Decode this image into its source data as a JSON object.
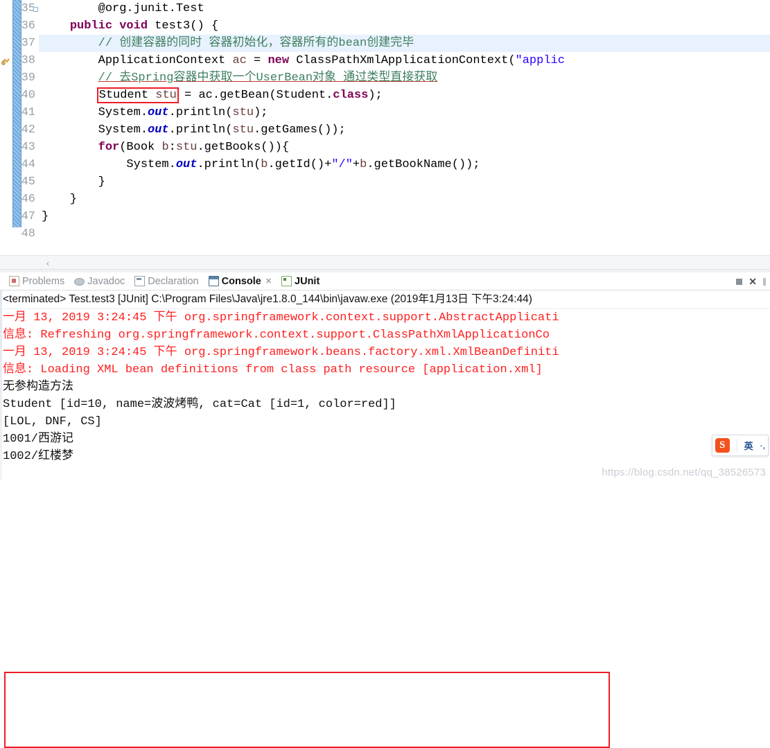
{
  "editor": {
    "first_line_number": 35,
    "lines": [
      {
        "num": 35,
        "folded": true,
        "highlight": false,
        "tokens": [
          {
            "t": "        ",
            "c": "plain"
          },
          {
            "t": "@org.junit.Test",
            "c": "plain"
          }
        ]
      },
      {
        "num": 36,
        "folded": false,
        "highlight": false,
        "tokens": [
          {
            "t": "    ",
            "c": "plain"
          },
          {
            "t": "public void",
            "c": "kw"
          },
          {
            "t": " test3() {",
            "c": "plain"
          }
        ]
      },
      {
        "num": 37,
        "folded": false,
        "highlight": true,
        "tokens": [
          {
            "t": "        ",
            "c": "plain"
          },
          {
            "t": "// 创建容器的同时 容器初始化，容器所有的bean创建完毕",
            "c": "cmt"
          }
        ]
      },
      {
        "num": 38,
        "folded": false,
        "highlight": false,
        "warn": true,
        "tokens": [
          {
            "t": "        ApplicationContext ",
            "c": "plain"
          },
          {
            "t": "ac",
            "c": "local"
          },
          {
            "t": " = ",
            "c": "plain"
          },
          {
            "t": "new",
            "c": "kw"
          },
          {
            "t": " ClassPathXmlApplicationContext(",
            "c": "plain"
          },
          {
            "t": "\"applic",
            "c": "str"
          }
        ]
      },
      {
        "num": 39,
        "folded": false,
        "highlight": false,
        "tokens": [
          {
            "t": "        ",
            "c": "plain"
          },
          {
            "t": "// 去Spring容器中获取一个UserBean对象 通过类型直接获取",
            "c": "cmt-u"
          }
        ]
      },
      {
        "num": 40,
        "folded": false,
        "highlight": false,
        "boxed": true,
        "tokens": [
          {
            "t": "        ",
            "c": "plain"
          },
          {
            "t": "Student ",
            "c": "plain",
            "box": true
          },
          {
            "t": "stu",
            "c": "local",
            "box": true
          },
          {
            "t": " = ac.getBean(Student.",
            "c": "plain"
          },
          {
            "t": "class",
            "c": "kw"
          },
          {
            "t": ");",
            "c": "plain"
          }
        ]
      },
      {
        "num": 41,
        "folded": false,
        "highlight": false,
        "tokens": [
          {
            "t": "        System.",
            "c": "plain"
          },
          {
            "t": "out",
            "c": "fld"
          },
          {
            "t": ".println(",
            "c": "plain"
          },
          {
            "t": "stu",
            "c": "local"
          },
          {
            "t": ");",
            "c": "plain"
          }
        ]
      },
      {
        "num": 42,
        "folded": false,
        "highlight": false,
        "tokens": [
          {
            "t": "        System.",
            "c": "plain"
          },
          {
            "t": "out",
            "c": "fld"
          },
          {
            "t": ".println(",
            "c": "plain"
          },
          {
            "t": "stu",
            "c": "local"
          },
          {
            "t": ".getGames());",
            "c": "plain"
          }
        ]
      },
      {
        "num": 43,
        "folded": false,
        "highlight": false,
        "tokens": [
          {
            "t": "        ",
            "c": "plain"
          },
          {
            "t": "for",
            "c": "kw"
          },
          {
            "t": "(Book ",
            "c": "plain"
          },
          {
            "t": "b",
            "c": "local"
          },
          {
            "t": ":",
            "c": "plain"
          },
          {
            "t": "stu",
            "c": "local"
          },
          {
            "t": ".getBooks()){",
            "c": "plain"
          }
        ]
      },
      {
        "num": 44,
        "folded": false,
        "highlight": false,
        "tokens": [
          {
            "t": "            System.",
            "c": "plain"
          },
          {
            "t": "out",
            "c": "fld"
          },
          {
            "t": ".println(",
            "c": "plain"
          },
          {
            "t": "b",
            "c": "local"
          },
          {
            "t": ".getId()+",
            "c": "plain"
          },
          {
            "t": "\"/\"",
            "c": "str"
          },
          {
            "t": "+",
            "c": "plain"
          },
          {
            "t": "b",
            "c": "local"
          },
          {
            "t": ".getBookName());",
            "c": "plain"
          }
        ]
      },
      {
        "num": 45,
        "folded": false,
        "highlight": false,
        "tokens": [
          {
            "t": "        }",
            "c": "plain"
          }
        ]
      },
      {
        "num": 46,
        "folded": false,
        "highlight": false,
        "tokens": [
          {
            "t": "    }",
            "c": "plain"
          }
        ]
      },
      {
        "num": 47,
        "folded": false,
        "highlight": false,
        "tokens": [
          {
            "t": "}",
            "c": "plain"
          }
        ]
      },
      {
        "num": 48,
        "folded": false,
        "highlight": false,
        "tokens": [
          {
            "t": "",
            "c": "plain"
          }
        ]
      }
    ],
    "hscroll_left_arrow": "‹"
  },
  "view_tabs": [
    {
      "label": "Problems",
      "icon": "problems-icon",
      "active": false,
      "closable": false
    },
    {
      "label": "Javadoc",
      "icon": "javadoc-icon",
      "active": false,
      "closable": false
    },
    {
      "label": "Declaration",
      "icon": "declaration-icon",
      "active": false,
      "closable": false
    },
    {
      "label": "Console",
      "icon": "console-icon",
      "active": true,
      "closable": true,
      "close_glyph": "✕"
    },
    {
      "label": "JUnit",
      "icon": "junit-icon",
      "active": false,
      "closable": false
    }
  ],
  "view_tools": {
    "minimize_title": "Minimize",
    "close_glyph": "✕",
    "maximize_title": "Maximize"
  },
  "console": {
    "terminated_line": "<terminated> Test.test3 [JUnit] C:\\Program Files\\Java\\jre1.8.0_144\\bin\\javaw.exe (2019年1月13日 下午3:24:44)",
    "log_lines": [
      {
        "text": "一月 13, 2019 3:24:45 下午 org.springframework.context.support.AbstractApplicati",
        "stream": "err"
      },
      {
        "text": "信息: Refreshing org.springframework.context.support.ClassPathXmlApplicationCo",
        "stream": "err"
      },
      {
        "text": "一月 13, 2019 3:24:45 下午 org.springframework.beans.factory.xml.XmlBeanDefiniti",
        "stream": "err"
      },
      {
        "text": "信息: Loading XML bean definitions from class path resource [application.xml]",
        "stream": "err"
      },
      {
        "text": "无参构造方法",
        "stream": "out"
      },
      {
        "text": "Student [id=10, name=波波烤鸭, cat=Cat [id=1, color=red]]",
        "stream": "out"
      },
      {
        "text": "[LOL, DNF, CS]",
        "stream": "out"
      },
      {
        "text": "1001/西游记",
        "stream": "out"
      },
      {
        "text": "1002/红楼梦",
        "stream": "out"
      }
    ]
  },
  "ime": {
    "logo_text": "S",
    "mode_label": "英",
    "extra_label": "·,"
  },
  "watermark": {
    "text": "https://blog.csdn.net/qq_38526573"
  },
  "colors": {
    "keyword": "#7f0055",
    "comment": "#3f7f5f",
    "string": "#2a00ff",
    "field": "#0000c0",
    "local_var": "#6a3e3e",
    "highlight_box": "#ee1c25",
    "current_line": "#e8f2fe",
    "console_error": "#ff2020",
    "diff_marker": "#6fa9dd"
  }
}
